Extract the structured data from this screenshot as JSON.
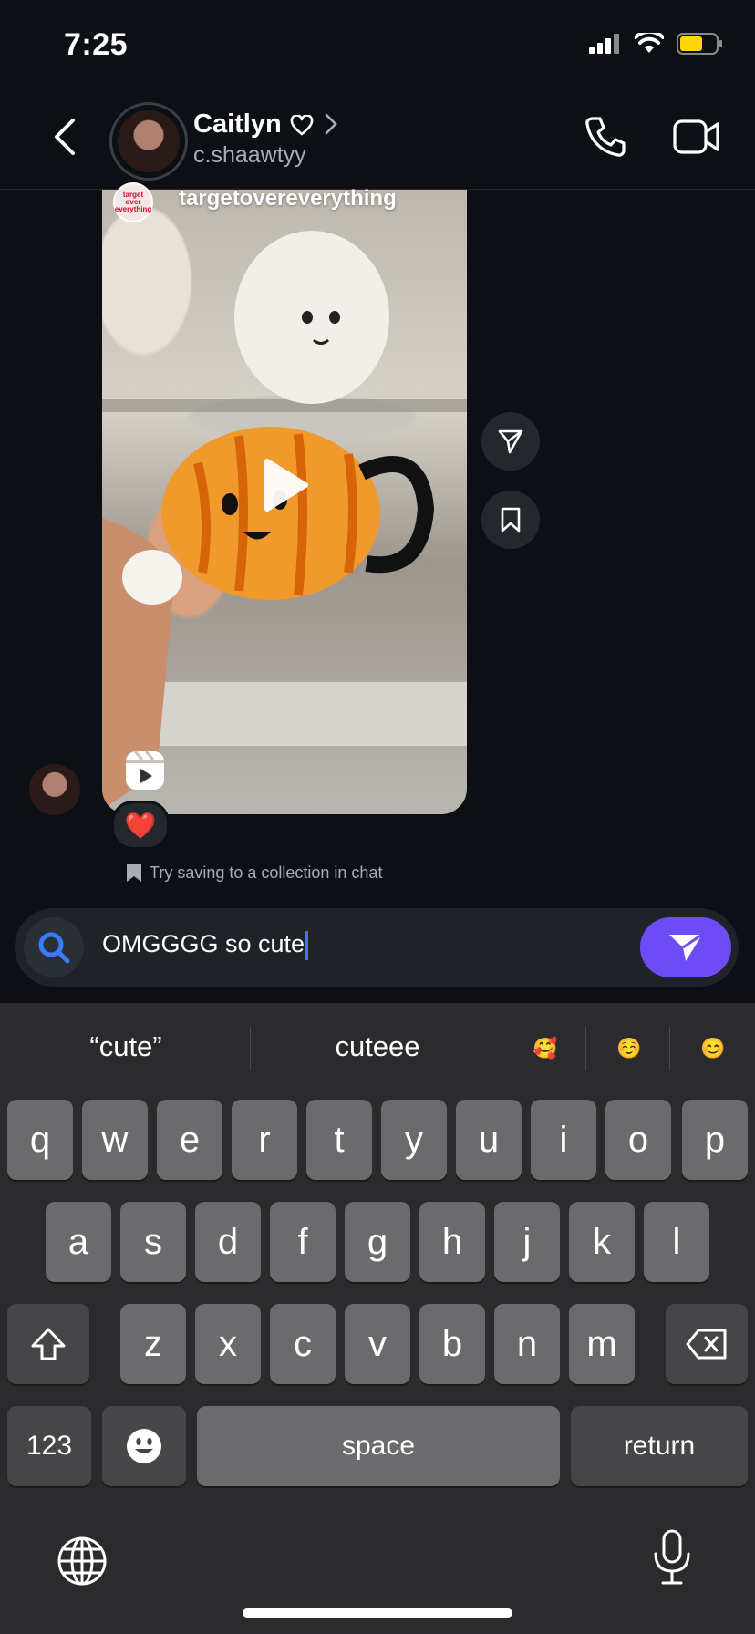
{
  "status": {
    "time": "7:25"
  },
  "header": {
    "name": "Caitlyn",
    "handle": "c.shaawtyy"
  },
  "reel": {
    "source": "targetovereverything",
    "source_avatar_text": "target over everything"
  },
  "reaction": {
    "emoji": "❤️"
  },
  "hint": {
    "text": "Try saving to a collection in chat"
  },
  "composer": {
    "value": "OMGGGG so cute"
  },
  "keyboard": {
    "suggestions": [
      "“cute”",
      "cuteee"
    ],
    "emoji_suggestions": [
      "🥰",
      "☺️",
      "😊"
    ],
    "row1": [
      "q",
      "w",
      "e",
      "r",
      "t",
      "y",
      "u",
      "i",
      "o",
      "p"
    ],
    "row2": [
      "a",
      "s",
      "d",
      "f",
      "g",
      "h",
      "j",
      "k",
      "l"
    ],
    "row3": [
      "z",
      "x",
      "c",
      "v",
      "b",
      "n",
      "m"
    ],
    "numbers": "123",
    "space": "space",
    "return": "return"
  },
  "colors": {
    "accent": "#6e4cf5",
    "background": "#0c1014",
    "keyboard": "#2b2b2d"
  }
}
